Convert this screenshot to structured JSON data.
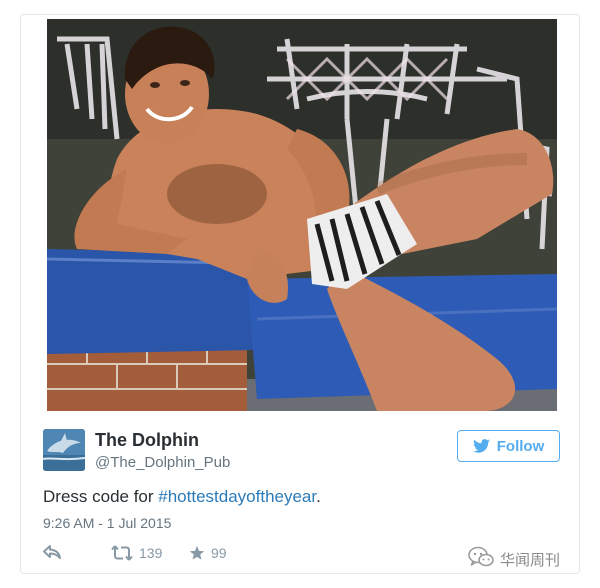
{
  "tweet": {
    "author_name": "The Dolphin",
    "author_handle": "@The_Dolphin_Pub",
    "follow_label": "Follow",
    "text_prefix": "Dress code for ",
    "hashtag": "#hottestdayoftheyear",
    "text_suffix": ".",
    "timestamp": "9:26 AM - 1 Jul 2015",
    "retweet_count": "139",
    "like_count": "99"
  },
  "watermark": {
    "text": "华闻周刊"
  },
  "colors": {
    "twitter_blue": "#55acee",
    "hashtag_blue": "#2b7bb9",
    "text_dark": "#292f33",
    "text_muted": "#66757f",
    "action_grey": "#8899a6"
  },
  "icons": {
    "reply": "reply-icon",
    "retweet": "retweet-icon",
    "like": "star-icon",
    "follow": "twitter-bird-icon",
    "watermark": "wechat-icon"
  }
}
